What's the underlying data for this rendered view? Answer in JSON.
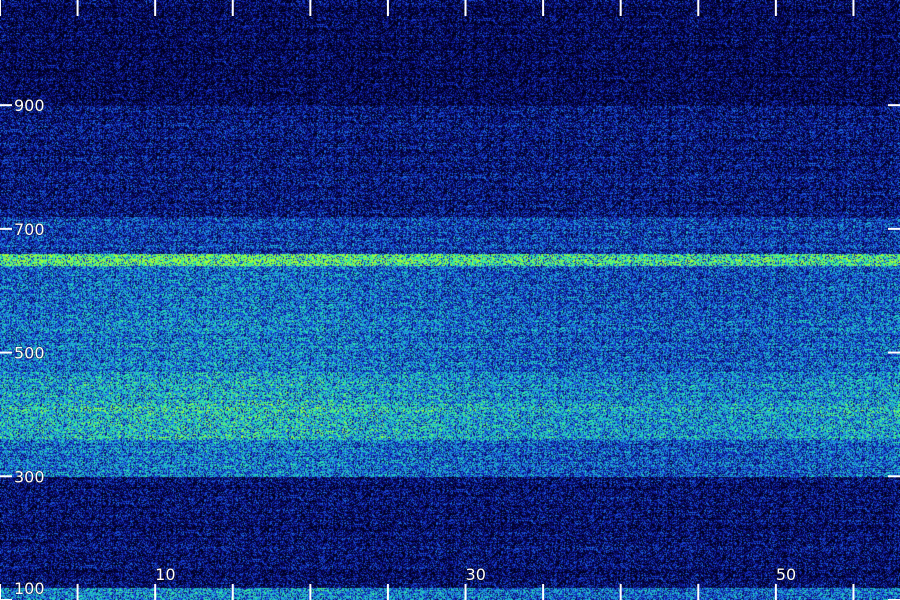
{
  "chart_data": {
    "type": "heatmap",
    "title": "",
    "xlabel": "",
    "ylabel": "",
    "xlim": [
      0,
      58
    ],
    "ylim": [
      100,
      1070
    ],
    "x_tick_labels": [
      "10",
      "30",
      "50"
    ],
    "x_tick_values": [
      10,
      30,
      50
    ],
    "x_minor_ticks": [
      0,
      5,
      10,
      15,
      20,
      25,
      30,
      35,
      40,
      45,
      50,
      55
    ],
    "y_tick_labels": [
      "100",
      "300",
      "500",
      "700",
      "900"
    ],
    "y_tick_values": [
      100,
      300,
      500,
      700,
      900
    ],
    "colormap": [
      "#000018",
      "#0a0a6e",
      "#1530c8",
      "#1e7ae6",
      "#20c8c8",
      "#30f0a0",
      "#a8ff30"
    ],
    "bands": [
      {
        "from": 100,
        "to": 120,
        "intensity": 0.55
      },
      {
        "from": 120,
        "to": 300,
        "intensity": 0.18
      },
      {
        "from": 300,
        "to": 360,
        "intensity": 0.5
      },
      {
        "from": 360,
        "to": 420,
        "intensity": 0.68
      },
      {
        "from": 420,
        "to": 470,
        "intensity": 0.62
      },
      {
        "from": 470,
        "to": 560,
        "intensity": 0.52
      },
      {
        "from": 560,
        "to": 640,
        "intensity": 0.48
      },
      {
        "from": 640,
        "to": 660,
        "intensity": 0.9
      },
      {
        "from": 660,
        "to": 720,
        "intensity": 0.38
      },
      {
        "from": 720,
        "to": 900,
        "intensity": 0.22
      },
      {
        "from": 900,
        "to": 1070,
        "intensity": 0.12
      }
    ],
    "grid": false,
    "legend": "none"
  }
}
